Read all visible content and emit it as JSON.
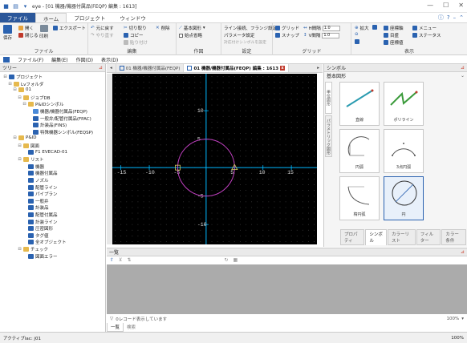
{
  "window": {
    "title": "eye - [01 機器/機器付属品(FEQP) 編集 : 1613]",
    "controls": [
      "—",
      "☐",
      "✕"
    ]
  },
  "menubar": {
    "tabs": [
      "ファイル",
      "ホーム",
      "プロジェクト",
      "ウィンドウ"
    ],
    "active": 1,
    "right_icons": [
      "ⓘ",
      "?",
      "–",
      "⌃"
    ]
  },
  "ribbon": {
    "groups": {
      "file": {
        "name": "ファイル",
        "save": "保存",
        "open": "開く",
        "close": "閉じる",
        "print": "印刷",
        "export": "エクスポート"
      },
      "edit": {
        "name": "編集",
        "undo": "元に戻す",
        "redo": "やり直す",
        "cut": "切り取り",
        "copy": "コピー",
        "paste": "貼り付け",
        "delete": "削除"
      },
      "draw": {
        "name": "作図",
        "basic_shapes": "基本図形",
        "snap_point": "始点省略"
      },
      "settings": {
        "name": "設定",
        "line_type": "ライン接続、フランジ設定",
        "param_settings": "パラメータ設定",
        "register_symbol": "対応付けシンボルを設定"
      },
      "grid": {
        "name": "グリッド",
        "grid": "グリッド",
        "snap": "スナップ",
        "h_interval_label": "H間隔",
        "h_interval_value": "1.0",
        "v_interval_label": "V間隔",
        "v_interval_value": "1.0"
      },
      "view": {
        "name": "表示",
        "zoom_in": "拡大",
        "zoom_out": "縮小",
        "coords": "座標軸",
        "eye": "目盛",
        "coords2": "座標値",
        "menu": "メニュー",
        "status": "ステータス"
      }
    }
  },
  "docbar": {
    "items": [
      "ファイル(F)",
      "編集(E)",
      "作図(D)",
      "表示(D)"
    ]
  },
  "tree": {
    "title": "ツリー",
    "nodes": [
      {
        "label": "プロジェクト",
        "exp": "⊟",
        "type": "item"
      },
      {
        "label": "Lvフォルダ",
        "exp": "⊟",
        "type": "folder"
      },
      {
        "label": "01",
        "exp": "⊟",
        "type": "folder"
      },
      {
        "label": "ジョブDB",
        "exp": "⊟",
        "type": "folder"
      },
      {
        "label": "P&IDシンボル",
        "exp": "⊟",
        "type": "folder"
      },
      {
        "label": "機器/機器付属品(FEQP)",
        "exp": "",
        "type": "sel"
      },
      {
        "label": "一般弁/配管付属品(FPAC)",
        "exp": "",
        "type": "item"
      },
      {
        "label": "計装品(FINS)",
        "exp": "",
        "type": "item"
      },
      {
        "label": "特殊機器シンボル(FEQSP)",
        "exp": "",
        "type": "item"
      },
      {
        "label": "P&ID",
        "exp": "⊟",
        "type": "folder"
      },
      {
        "label": "図面",
        "exp": "⊟",
        "type": "folder"
      },
      {
        "label": "F1 EVECAD-01",
        "exp": "",
        "type": "item"
      },
      {
        "label": "リスト",
        "exp": "⊟",
        "type": "folder"
      },
      {
        "label": "機器",
        "exp": "",
        "type": "item"
      },
      {
        "label": "機器付属品",
        "exp": "",
        "type": "item"
      },
      {
        "label": "ノズル",
        "exp": "",
        "type": "item"
      },
      {
        "label": "配管ライン",
        "exp": "",
        "type": "item"
      },
      {
        "label": "パイプラン",
        "exp": "",
        "type": "item"
      },
      {
        "label": "一般弁",
        "exp": "",
        "type": "item"
      },
      {
        "label": "計装品",
        "exp": "",
        "type": "item"
      },
      {
        "label": "配管付属品",
        "exp": "",
        "type": "item"
      },
      {
        "label": "計装ライン",
        "exp": "",
        "type": "item"
      },
      {
        "label": "圧密図形",
        "exp": "",
        "type": "item"
      },
      {
        "label": "タグ値",
        "exp": "",
        "type": "item"
      },
      {
        "label": "全オブジェクト",
        "exp": "",
        "type": "item"
      },
      {
        "label": "チェック",
        "exp": "⊟",
        "type": "folder"
      },
      {
        "label": "図面エラー",
        "exp": "",
        "type": "item"
      }
    ]
  },
  "doc_tabs": [
    {
      "label": "01 機器/機器付属品(FEQP)",
      "active": false
    },
    {
      "label": "01 機器/機器付属品(FEQP) 編集 : 1613",
      "active": true
    }
  ],
  "canvas": {
    "x_ticks": [
      "-15",
      "-10",
      "-5",
      "5",
      "10",
      "15"
    ],
    "y_ticks": [
      "10",
      "5",
      "-5",
      "-10"
    ],
    "circle_radius_units": 5,
    "view_range": {
      "x": [
        -16.5,
        19.5
      ],
      "y": [
        -13.5,
        16.5
      ]
    },
    "colors": {
      "grid": "#3a3a3a",
      "axis": "#00b8ff",
      "circle": "#c040c0",
      "marker": "#d8c860"
    }
  },
  "symbol_panel": {
    "title": "シンボル",
    "section": "基本図形",
    "vertical_tabs": [
      "単位図形",
      "パラメトリック図形"
    ],
    "cards": [
      {
        "label": "直線"
      },
      {
        "label": "ポリライン"
      },
      {
        "label": "円弧"
      },
      {
        "label": "3点円弧"
      },
      {
        "label": "楕円弧"
      },
      {
        "label": "円"
      }
    ],
    "bottom_tabs": [
      "プロパティ",
      "シンボル",
      "カラーリスト",
      "フィルター",
      "カラー条件"
    ],
    "active_bottom_tab": 1
  },
  "list_panel": {
    "title": "一覧",
    "footer_text": "0レコード表示しています",
    "zoom": "100%",
    "tabs": [
      "一覧",
      "検索"
    ]
  },
  "status": {
    "left": "アクティブlac: j01",
    "right": "100%"
  }
}
